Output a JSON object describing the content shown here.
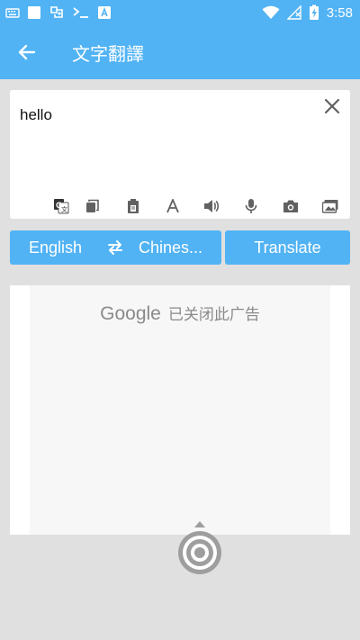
{
  "status_bar": {
    "time": "3:58",
    "icons": [
      "keyboard-icon",
      "square-icon",
      "app-icon",
      "terminal-icon",
      "font-app-icon",
      "wifi-icon",
      "signal-icon",
      "battery-charging-icon"
    ]
  },
  "app_bar": {
    "title": "文字翻譯",
    "back_icon": "arrow-left-icon"
  },
  "input": {
    "value": "hello",
    "clear_icon": "close-icon",
    "tools": [
      "google-translate-icon",
      "copy-icon",
      "paste-icon",
      "font-icon",
      "speaker-icon",
      "mic-icon",
      "camera-icon",
      "gallery-icon"
    ]
  },
  "language": {
    "source": "English",
    "target": "Chines...",
    "swap_icon": "swap-icon"
  },
  "translate_label": "Translate",
  "ad": {
    "brand": "Google",
    "message": "已关闭此广告"
  },
  "colors": {
    "primary": "#51b3f4",
    "background": "#e0e0e0",
    "icon_gray": "#616161"
  }
}
